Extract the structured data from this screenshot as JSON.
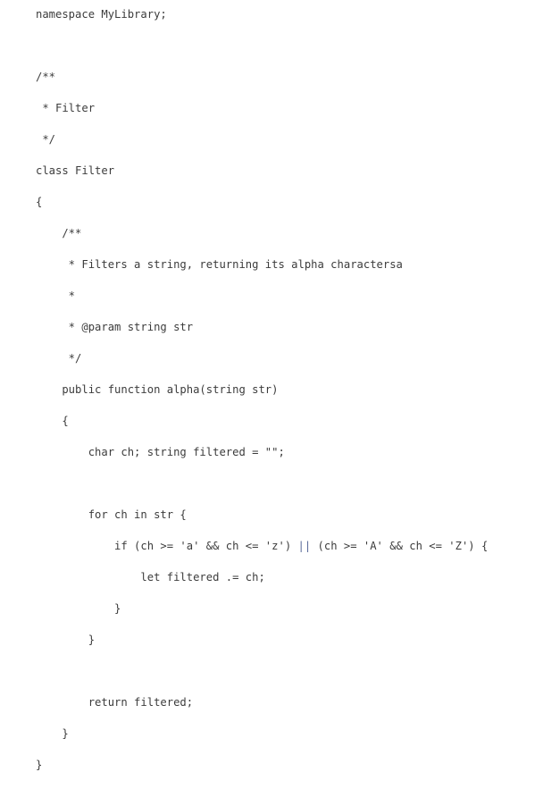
{
  "document": {
    "kind": "source-code-listing",
    "language": "php-like",
    "namespace": "MyLibrary",
    "class_name": "Filter",
    "method_name": "alpha",
    "background_color": "#ffffff",
    "text_color": "#3c3c3c",
    "operator_or_color": "#5a6b9a",
    "font_size_px": "12.2",
    "line_height_px": "17.5"
  },
  "code": {
    "lines": [
      "namespace MyLibrary;",
      "",
      "/**",
      " * Filter",
      " */",
      "class Filter",
      "{",
      "    /**",
      "     * Filters a string, returning its alpha charactersa",
      "     *",
      "     * @param string str",
      "     */",
      "    public function alpha(string str)",
      "    {",
      "        char ch; string filtered = \"\";",
      "",
      "        for ch in str {",
      "            if (ch >= 'a' && ch <= 'z') || (ch >= 'A' && ch <= 'Z') {",
      "                let filtered .= ch;",
      "            }",
      "        }",
      "",
      "        return filtered;",
      "    }",
      "}"
    ],
    "or_operator_line_index": 17,
    "or_operator_token": "||"
  }
}
